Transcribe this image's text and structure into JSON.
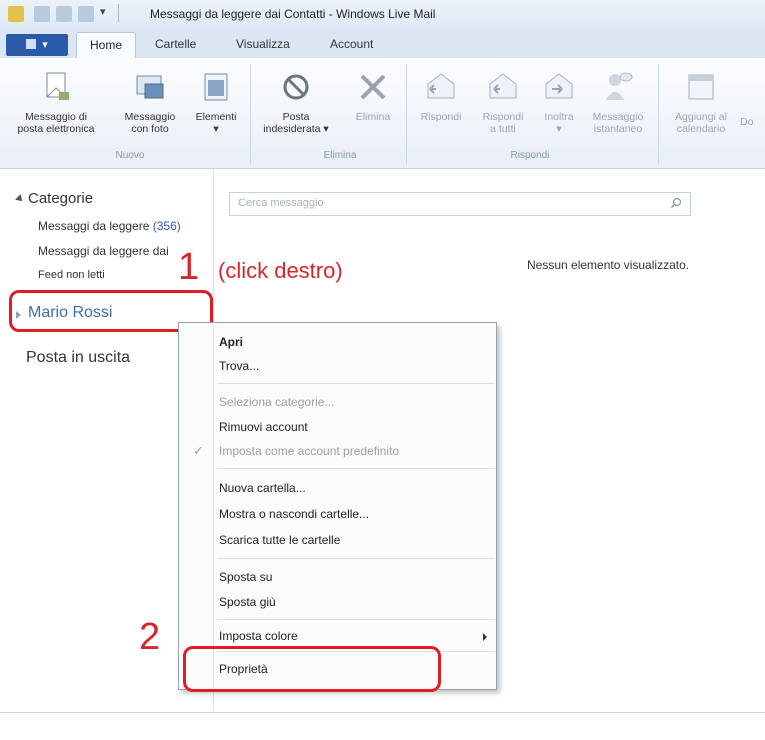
{
  "window": {
    "title": "Messaggi da leggere dai Contatti - Windows Live Mail"
  },
  "tabs": [
    "Home",
    "Cartelle",
    "Visualizza",
    "Account"
  ],
  "ribbon": {
    "groups": [
      {
        "label": "Nuovo",
        "buttons": [
          "Messaggio di posta elettronica",
          "Messaggio con foto",
          "Elementi"
        ]
      },
      {
        "label": "Elimina",
        "buttons": [
          "Posta indesiderata",
          "Elimina"
        ]
      },
      {
        "label": "Rispondi",
        "buttons": [
          "Rispondi",
          "Rispondi a tutti",
          "Inoltra",
          "Messaggio istantaneo"
        ]
      }
    ],
    "b_nuovo_1a": "Messaggio di",
    "b_nuovo_1b": "posta elettronica",
    "b_nuovo_2a": "Messaggio",
    "b_nuovo_2b": "con foto",
    "b_nuovo_3a": "Elementi",
    "b_el_1a": "Posta",
    "b_el_1b": "indesiderata",
    "b_el_2a": "Elimina",
    "b_r_1a": "Rispondi",
    "b_r_2a": "Rispondi",
    "b_r_2b": "a tutti",
    "b_r_3a": "Inoltra",
    "b_r_4a": "Messaggio",
    "b_r_4b": "istantaneo",
    "b_cal_a": "Aggiungi al",
    "b_cal_b": "calendario",
    "b_cal_trunc": "Do"
  },
  "nav": {
    "categories_header": "Categorie",
    "cat_1_label": "Messaggi da leggere ",
    "cat_1_count": "(356)",
    "cat_2_label": "Messaggi da leggere dai",
    "cat_3_label": "Feed non letti",
    "account": "Mario Rossi",
    "outbox": "Posta in uscita"
  },
  "search": {
    "placeholder": "Cerca messaggio"
  },
  "main": {
    "empty_message": "Nessun elemento visualizzato."
  },
  "annotations": {
    "step1_number": "1",
    "step1_text": "(click destro)",
    "step2_number": "2"
  },
  "context_menu": {
    "items": [
      "Apri",
      "Trova...",
      "Seleziona categorie...",
      "Rimuovi account",
      "Imposta come account predefinito",
      "Nuova cartella...",
      "Mostra o nascondi cartelle...",
      "Scarica tutte le cartelle",
      "Sposta su",
      "Sposta giù",
      "Imposta colore",
      "Proprietà"
    ],
    "check": "✓"
  },
  "colors": {
    "accent": "#2a5aa8",
    "annotation": "#d9262b",
    "highlight_box": "#e11d24"
  }
}
